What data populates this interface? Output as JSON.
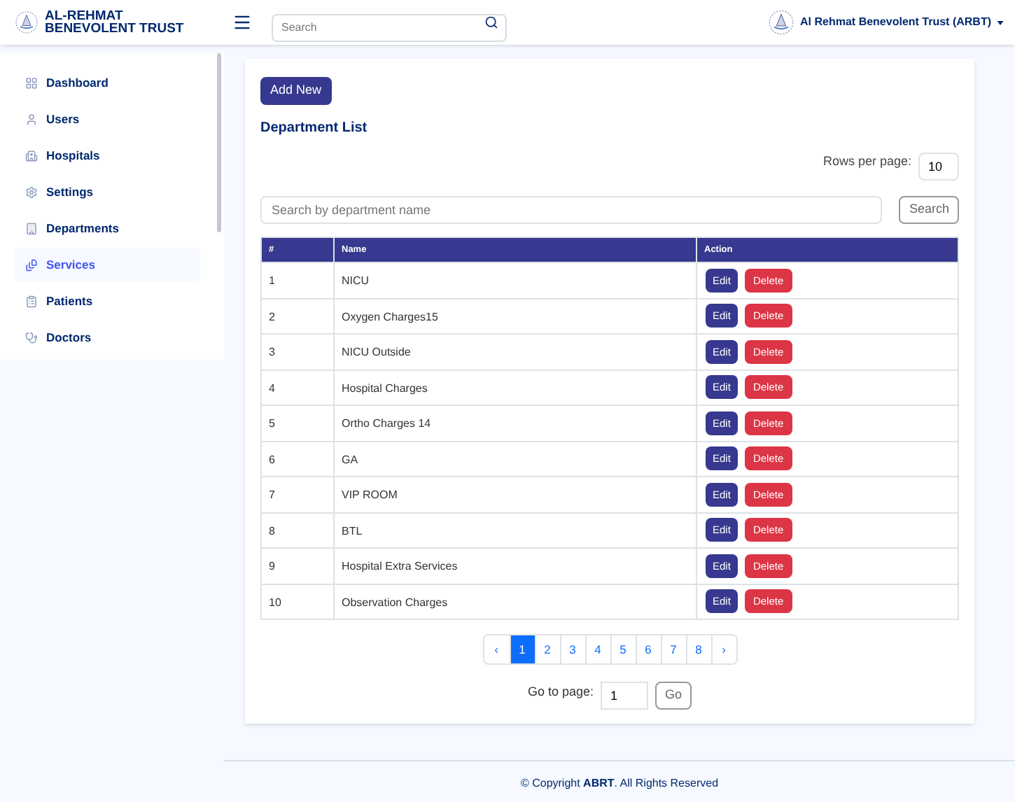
{
  "header": {
    "brand": "AL-REHMAT BENEVOLENT TRUST",
    "search": {
      "placeholder": "Search"
    },
    "account": "Al Rehmat Benevolent Trust (ARBT)"
  },
  "sidebar": {
    "items": [
      {
        "label": "Dashboard",
        "selected": false
      },
      {
        "label": "Users",
        "selected": false
      },
      {
        "label": "Hospitals",
        "selected": false
      },
      {
        "label": "Settings",
        "selected": false
      },
      {
        "label": "Departments",
        "selected": false
      },
      {
        "label": "Services",
        "selected": true
      },
      {
        "label": "Patients",
        "selected": false
      },
      {
        "label": "Doctors",
        "selected": false
      }
    ]
  },
  "content": {
    "add_button": "Add New",
    "title": "Department List",
    "rows_per_page": {
      "label": "Rows per page:",
      "value": "10"
    },
    "search": {
      "placeholder": "Search by department name",
      "button": "Search"
    },
    "table": {
      "columns": [
        "#",
        "Name",
        "Action"
      ],
      "rows": [
        {
          "num": "1",
          "name": "NICU",
          "edit": "Edit",
          "delete": "Delete"
        },
        {
          "num": "2",
          "name": "Oxygen Charges15",
          "edit": "Edit",
          "delete": "Delete"
        },
        {
          "num": "3",
          "name": "NICU Outside",
          "edit": "Edit",
          "delete": "Delete"
        },
        {
          "num": "4",
          "name": "Hospital Charges",
          "edit": "Edit",
          "delete": "Delete"
        },
        {
          "num": "5",
          "name": "Ortho Charges 14",
          "edit": "Edit",
          "delete": "Delete"
        },
        {
          "num": "6",
          "name": "GA",
          "edit": "Edit",
          "delete": "Delete"
        },
        {
          "num": "7",
          "name": "VIP ROOM",
          "edit": "Edit",
          "delete": "Delete"
        },
        {
          "num": "8",
          "name": "BTL",
          "edit": "Edit",
          "delete": "Delete"
        },
        {
          "num": "9",
          "name": "Hospital Extra Services",
          "edit": "Edit",
          "delete": "Delete"
        },
        {
          "num": "10",
          "name": "Observation Charges",
          "edit": "Edit",
          "delete": "Delete"
        }
      ]
    },
    "pagination": [
      {
        "label": "‹",
        "selected": false
      },
      {
        "label": "1",
        "selected": true
      },
      {
        "label": "2",
        "selected": false
      },
      {
        "label": "3",
        "selected": false
      },
      {
        "label": "4",
        "selected": false
      },
      {
        "label": "5",
        "selected": false
      },
      {
        "label": "6",
        "selected": false
      },
      {
        "label": "7",
        "selected": false
      },
      {
        "label": "8",
        "selected": false
      },
      {
        "label": "›",
        "selected": false
      }
    ],
    "goto": {
      "label": "Go to page:",
      "value": "1",
      "button": "Go"
    }
  },
  "footer": {
    "text": "© Copyright **ABRT**. All Rights Reserved"
  }
}
